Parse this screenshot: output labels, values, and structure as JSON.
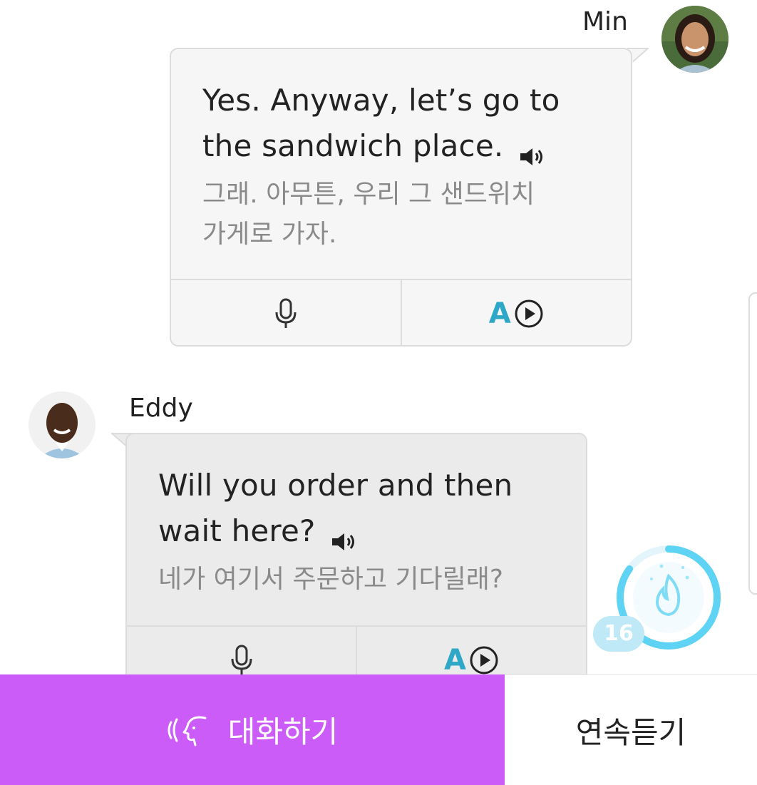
{
  "messages": [
    {
      "sender": "Min",
      "english": "Yes. Anyway, let’s go to the sandwich place.",
      "korean": "그래. 아무튼, 우리 그 샌드위치 가게로 가자.",
      "english_lines": [
        "Yes. Anyway, let’s go to",
        "the sandwich place."
      ],
      "korean_lines": [
        "그래. 아무튼, 우리 그 샌드위치",
        "가게로 가자."
      ],
      "speaker_icon": "speaker-icon",
      "actions": [
        {
          "icon": "microphone-icon"
        },
        {
          "label": "A",
          "icon": "play-circle-icon"
        }
      ]
    },
    {
      "sender": "Eddy",
      "english_lines": [
        "Will you order and then",
        "wait here?"
      ],
      "korean_lines": [
        "네가 여기서 주문하고 기다릴래?"
      ],
      "speaker_icon": "speaker-icon",
      "actions": [
        {
          "icon": "microphone-icon"
        },
        {
          "label": "A",
          "icon": "play-circle-icon"
        }
      ]
    }
  ],
  "streak": {
    "count": "16",
    "icon": "flame-icon",
    "progress": 0.85
  },
  "bottom_bar": {
    "talk_label": "대화하기",
    "talk_icon": "speaking-head-icon",
    "listen_label": "연속듣기"
  },
  "colors": {
    "accent_purple": "#cc5cf7",
    "accent_teal": "#2fa8c8",
    "streak_blue": "#5fd3f3"
  }
}
